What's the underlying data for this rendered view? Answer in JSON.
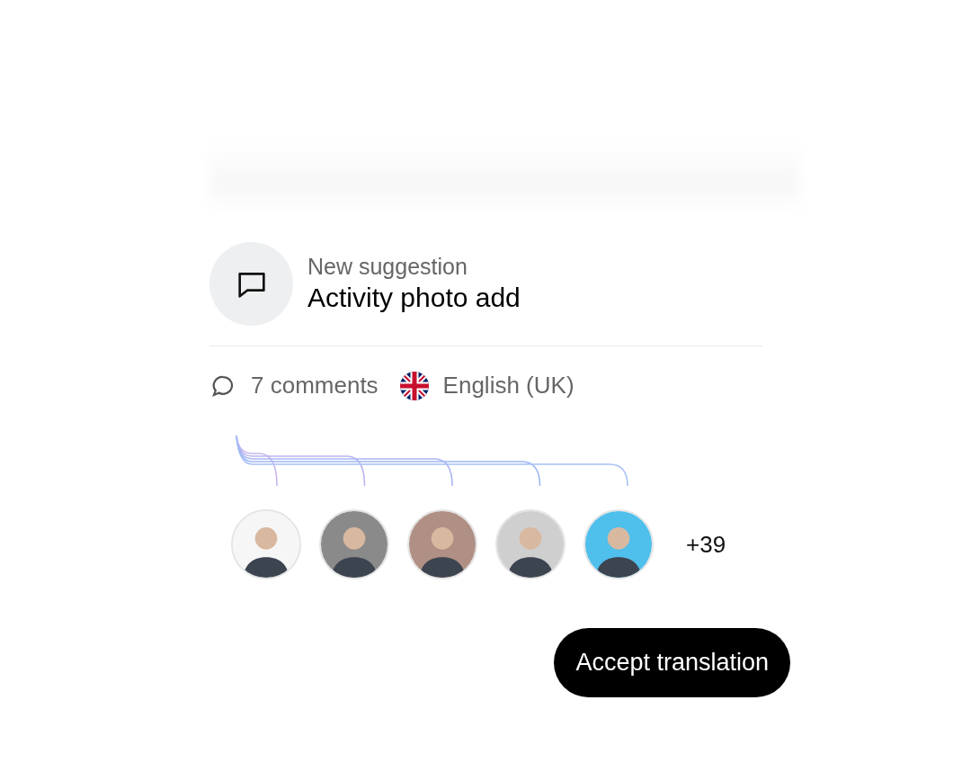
{
  "notification": {
    "label": "New suggestion",
    "title": "Activity photo add"
  },
  "meta": {
    "comments": "7 comments",
    "language": "English (UK)"
  },
  "avatars": [
    {
      "color": "#f6f6f6"
    },
    {
      "color": "#8a8a8a"
    },
    {
      "color": "#b08f84"
    },
    {
      "color": "#cfcfcf"
    },
    {
      "color": "#4fbfec"
    }
  ],
  "more_count": "+39",
  "button": "Accept translation"
}
